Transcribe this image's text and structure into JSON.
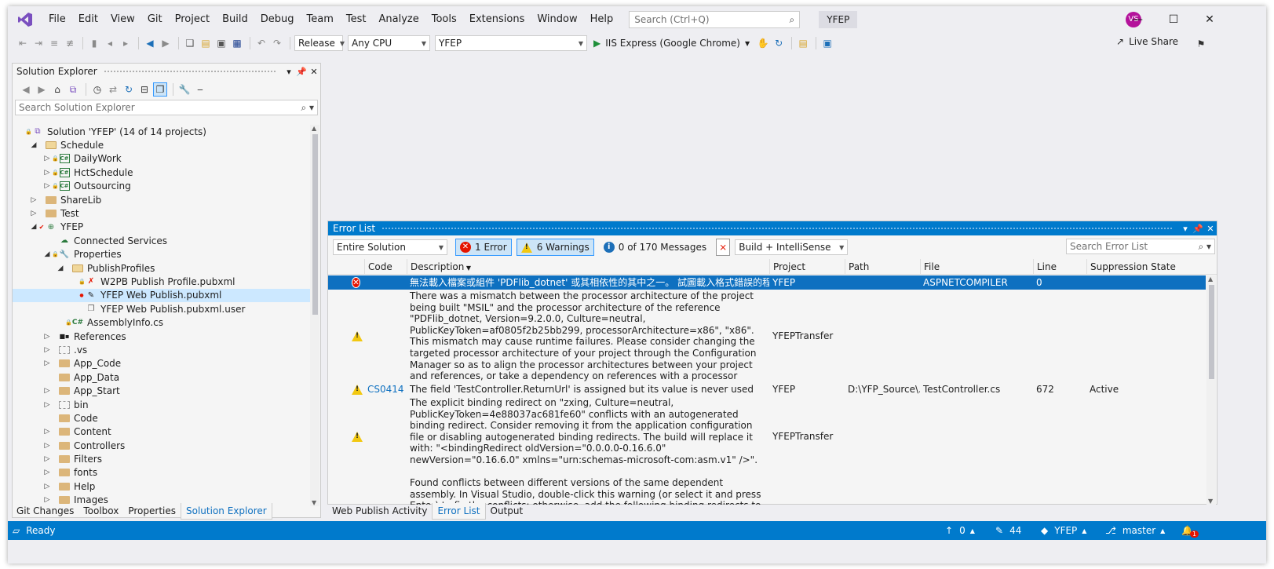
{
  "titlebar": {
    "menu": [
      "File",
      "Edit",
      "View",
      "Git",
      "Project",
      "Build",
      "Debug",
      "Team",
      "Test",
      "Analyze",
      "Tools",
      "Extensions",
      "Window",
      "Help"
    ],
    "search_placeholder": "Search (Ctrl+Q)",
    "solution_name": "YFEP",
    "avatar_initials": "VS"
  },
  "toolbar": {
    "configuration": "Release",
    "platform": "Any CPU",
    "startup_project": "YFEP",
    "run_target": "IIS Express (Google Chrome)",
    "live_share": "Live Share"
  },
  "solution_explorer": {
    "title": "Solution Explorer",
    "search_placeholder": "Search Solution Explorer",
    "tree": [
      {
        "label": "Solution 'YFEP' (14 of 14 projects)",
        "indent": 0,
        "icon": "solution",
        "expander": "",
        "lock": true
      },
      {
        "label": "Schedule",
        "indent": 1,
        "icon": "folder-open",
        "expander": "open",
        "lock": false
      },
      {
        "label": "DailyWork",
        "indent": 2,
        "icon": "csproj",
        "expander": "closed",
        "lock": true
      },
      {
        "label": "HctSchedule",
        "indent": 2,
        "icon": "csproj",
        "expander": "closed",
        "lock": true
      },
      {
        "label": "Outsourcing",
        "indent": 2,
        "icon": "csproj",
        "expander": "closed",
        "lock": true
      },
      {
        "label": "ShareLib",
        "indent": 1,
        "icon": "folder",
        "expander": "closed",
        "lock": false
      },
      {
        "label": "Test",
        "indent": 1,
        "icon": "folder",
        "expander": "closed",
        "lock": false
      },
      {
        "label": "YFEP",
        "indent": 1,
        "icon": "webproj",
        "expander": "open",
        "lock": false,
        "check": true
      },
      {
        "label": "Connected Services",
        "indent": 2,
        "icon": "connected",
        "expander": "",
        "lock": false
      },
      {
        "label": "Properties",
        "indent": 2,
        "icon": "wrench",
        "expander": "open",
        "lock": true
      },
      {
        "label": "PublishProfiles",
        "indent": 3,
        "icon": "folder-open",
        "expander": "open",
        "lock": false
      },
      {
        "label": "W2PB Publish Profile.pubxml",
        "indent": 4,
        "icon": "file-x",
        "expander": "",
        "lock": true
      },
      {
        "label": "YFEP Web Publish.pubxml",
        "indent": 4,
        "icon": "file-edit",
        "expander": "",
        "lock": false,
        "selected": true,
        "dot": true
      },
      {
        "label": "YFEP Web Publish.pubxml.user",
        "indent": 4,
        "icon": "file",
        "expander": "",
        "lock": false
      },
      {
        "label": "AssemblyInfo.cs",
        "indent": 3,
        "icon": "cs",
        "expander": "",
        "lock": true
      },
      {
        "label": "References",
        "indent": 2,
        "icon": "refs",
        "expander": "closed",
        "lock": false
      },
      {
        "label": ".vs",
        "indent": 2,
        "icon": "folder-dashed",
        "expander": "closed",
        "lock": false
      },
      {
        "label": "App_Code",
        "indent": 2,
        "icon": "folder",
        "expander": "closed",
        "lock": false
      },
      {
        "label": "App_Data",
        "indent": 2,
        "icon": "folder",
        "expander": "",
        "lock": false
      },
      {
        "label": "App_Start",
        "indent": 2,
        "icon": "folder",
        "expander": "closed",
        "lock": false
      },
      {
        "label": "bin",
        "indent": 2,
        "icon": "folder-dashed",
        "expander": "closed",
        "lock": false
      },
      {
        "label": "Code",
        "indent": 2,
        "icon": "folder",
        "expander": "",
        "lock": false
      },
      {
        "label": "Content",
        "indent": 2,
        "icon": "folder",
        "expander": "closed",
        "lock": false
      },
      {
        "label": "Controllers",
        "indent": 2,
        "icon": "folder",
        "expander": "closed",
        "lock": false
      },
      {
        "label": "Filters",
        "indent": 2,
        "icon": "folder",
        "expander": "closed",
        "lock": false
      },
      {
        "label": "fonts",
        "indent": 2,
        "icon": "folder",
        "expander": "closed",
        "lock": false
      },
      {
        "label": "Help",
        "indent": 2,
        "icon": "folder",
        "expander": "closed",
        "lock": false
      },
      {
        "label": "Images",
        "indent": 2,
        "icon": "folder",
        "expander": "closed",
        "lock": false
      }
    ]
  },
  "left_tabs": [
    "Git Changes",
    "Toolbox",
    "Properties",
    "Solution Explorer"
  ],
  "left_tabs_active": 3,
  "error_list": {
    "title": "Error List",
    "scope": "Entire Solution",
    "errors_label": "1 Error",
    "warnings_label": "6 Warnings",
    "messages_label": "0 of 170 Messages",
    "source": "Build + IntelliSense",
    "search_placeholder": "Search Error List",
    "columns": [
      "Code",
      "Description",
      "Project",
      "Path",
      "File",
      "Line",
      "Suppression State"
    ],
    "rows": [
      {
        "severity": "error",
        "code": "",
        "description": "無法載入檔案或組件 'PDFlib_dotnet' 或其相依性的其中之一。 試圖載入格式錯誤的程式。",
        "project": "YFEP",
        "path": "",
        "file": "ASPNETCOMPILER",
        "line": "0",
        "state": "",
        "selected": true
      },
      {
        "severity": "warning",
        "code": "",
        "description": "There was a mismatch between the processor architecture of the project being built \"MSIL\" and the processor architecture of the reference \"PDFlib_dotnet, Version=9.2.0.0, Culture=neutral, PublicKeyToken=af0805f2b25bb299, processorArchitecture=x86\", \"x86\". This mismatch may cause runtime failures. Please consider changing the targeted processor architecture of your project through the Configuration Manager so as to align the processor architectures between your project and references, or take a dependency on references with a processor architecture that matches the targeted processor architecture of your project.",
        "project": "YFEPTransfer",
        "path": "",
        "file": "",
        "line": "",
        "state": ""
      },
      {
        "severity": "warning",
        "code": "CS0414",
        "description": "The field 'TestController.ReturnUrl' is assigned but its value is never used",
        "project": "YFEP",
        "path": "D:\\YFP_Source\\...",
        "file": "TestController.cs",
        "line": "672",
        "state": "Active"
      },
      {
        "severity": "warning",
        "code": "",
        "description": "The explicit binding redirect on \"zxing, Culture=neutral, PublicKeyToken=4e88037ac681fe60\" conflicts with an autogenerated binding redirect. Consider removing it from the application configuration file or disabling autogenerated binding redirects. The build will replace it with: \"<bindingRedirect oldVersion=\"0.0.0.0-0.16.6.0\" newVersion=\"0.16.6.0\" xmlns=\"urn:schemas-microsoft-com:asm.v1\" />\".",
        "project": "YFEPTransfer",
        "path": "",
        "file": "",
        "line": "",
        "state": ""
      },
      {
        "severity": "",
        "code": "",
        "description": "Found conflicts between different versions of the same dependent assembly. In Visual Studio, double-click this warning (or select it and press Enter) to fix the conflicts; otherwise, add the following binding redirects to the \"runtime\" node in the",
        "project": "",
        "path": "",
        "file": "",
        "line": "",
        "state": ""
      }
    ]
  },
  "bottom_tabs": [
    "Web Publish Activity",
    "Error List",
    "Output"
  ],
  "bottom_tabs_active": 1,
  "status_bar": {
    "ready": "Ready",
    "up_count": "0",
    "pencil_count": "44",
    "repo": "YFEP",
    "branch": "master",
    "notifications": "1"
  },
  "colors": {
    "accent": "#007acc",
    "error": "#e51400",
    "warning": "#f2c811",
    "selection": "#0e70c0"
  }
}
